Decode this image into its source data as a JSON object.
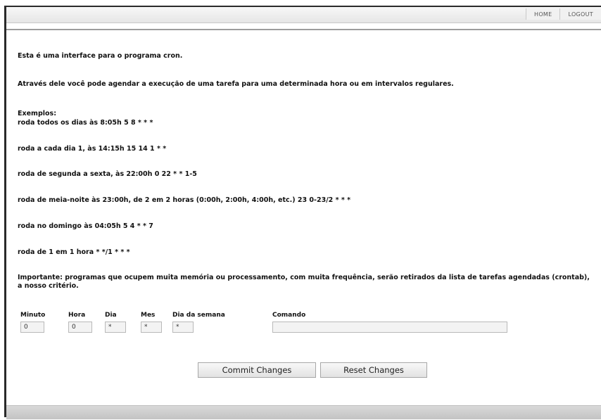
{
  "nav": {
    "home": "HOME",
    "logout": "LOGOUT"
  },
  "intro": {
    "line1": "Esta é uma interface para o programa cron.",
    "line2": "Através dele você pode agendar a execução de uma tarefa para uma determinada hora ou em intervalos regulares.",
    "examples_title": "Exemplos:",
    "examples": [
      "roda todos os dias às 8:05h 5 8 * * *",
      "roda a cada dia 1, às 14:15h 15 14 1 * *",
      "roda de segunda a sexta, às 22:00h 0 22 * * 1-5",
      "roda de meia-noite às 23:00h, de 2 em 2 horas (0:00h, 2:00h, 4:00h, etc.) 23 0-23/2 * * *",
      "roda no domingo às 04:05h 5 4 * * 7",
      "roda de 1 em 1 hora * */1 * * *"
    ],
    "warning": "Importante: programas que ocupem muita memória ou processamento, com muita frequência, serão retirados da lista de tarefas agendadas (crontab), a nosso critério."
  },
  "form": {
    "labels": {
      "minuto": "Minuto",
      "hora": "Hora",
      "dia": "Dia",
      "mes": "Mes",
      "dia_semana": "Dia da semana",
      "comando": "Comando"
    },
    "values": {
      "minuto": "0",
      "hora": "0",
      "dia": "*",
      "mes": "*",
      "dia_semana": "*",
      "comando": ""
    },
    "buttons": {
      "commit": "Commit Changes",
      "reset": "Reset Changes"
    }
  }
}
